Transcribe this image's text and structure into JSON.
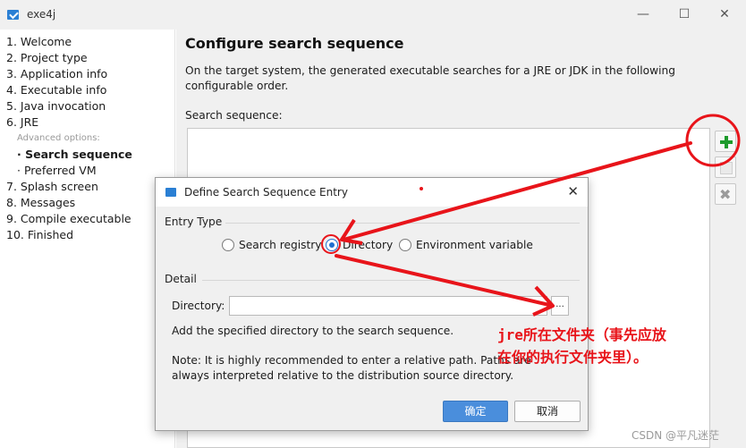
{
  "window": {
    "title": "exe4j",
    "minimize_glyph": "—",
    "maximize_glyph": "☐",
    "close_glyph": "✕"
  },
  "sidebar": {
    "steps": [
      "1. Welcome",
      "2. Project type",
      "3. Application info",
      "4. Executable info",
      "5. Java invocation",
      "6. JRE"
    ],
    "advanced_caption": "Advanced options:",
    "sub_steps": [
      "Search sequence",
      "Preferred VM"
    ],
    "more_steps": [
      "7. Splash screen",
      "8. Messages",
      "9. Compile executable",
      "10. Finished"
    ]
  },
  "main": {
    "heading": "Configure search sequence",
    "description": "On the target system, the generated executable searches for a JRE or JDK in the following configurable order.",
    "search_label": "Search sequence:",
    "buttons": {
      "add_icon": "plus-icon",
      "edit_icon": "edit-icon",
      "delete_icon": "delete-icon"
    }
  },
  "dialog": {
    "title": "Define Search Sequence Entry",
    "entry_type_label": "Entry Type",
    "options": [
      "Search registry",
      "Directory",
      "Environment variable"
    ],
    "selected": "Directory",
    "detail_label": "Detail",
    "directory_label": "Directory:",
    "directory_value": "",
    "browse_label": "...",
    "hint": "Add the specified directory to the search sequence.",
    "note": "Note: It is highly recommended to enter a relative path. Paths are always interpreted relative to the distribution source directory.",
    "ok_label": "确定",
    "cancel_label": "取消"
  },
  "annotation": {
    "line1": "jre所在文件夹（事先应放",
    "line2": "在你的执行文件夹里）。",
    "color": "#e8141a"
  },
  "watermark": "CSDN @平凡迷茫"
}
